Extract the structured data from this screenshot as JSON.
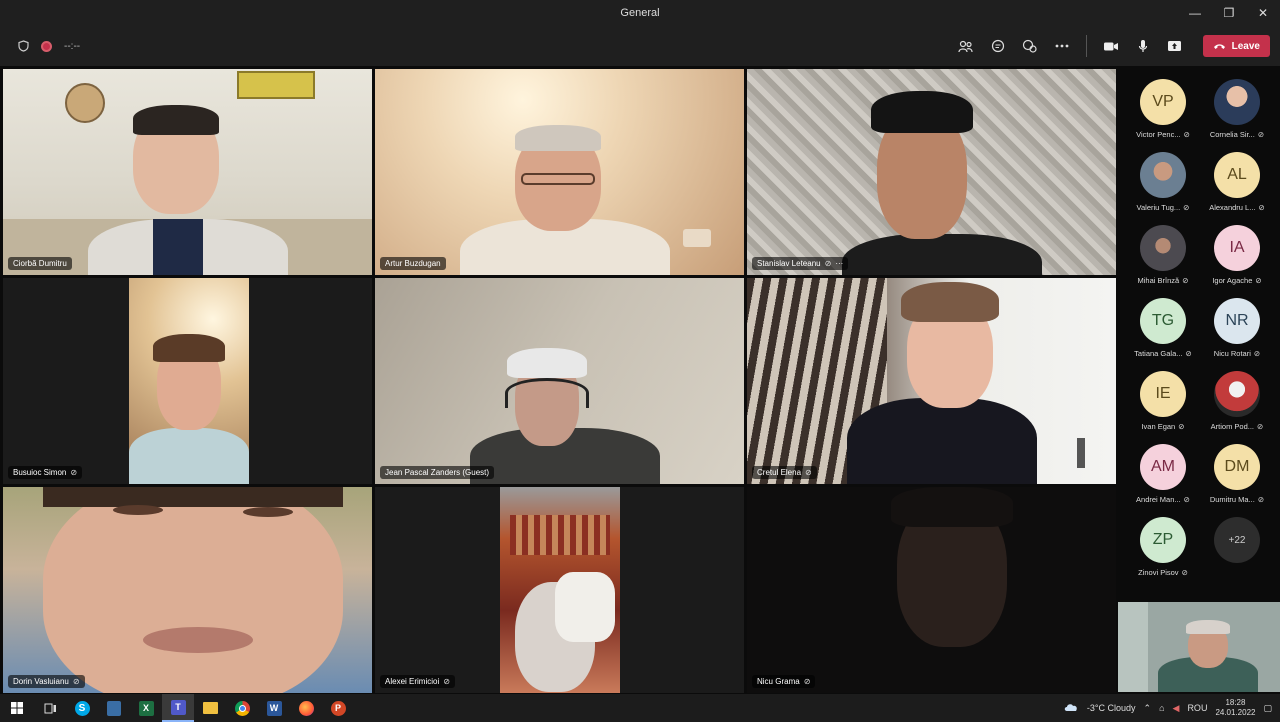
{
  "window": {
    "title": "General",
    "minimize": "—",
    "maximize": "❐",
    "close": "✕"
  },
  "toolbar": {
    "timer": "--:--",
    "leave_label": "Leave"
  },
  "tiles": [
    {
      "name": "Ciorbă Dumitru",
      "muted": false
    },
    {
      "name": "Artur Buzdugan",
      "muted": false
    },
    {
      "name": "Stanislav Leteanu",
      "muted": true,
      "more": "···"
    },
    {
      "name": "Busuioc Simon",
      "muted": true
    },
    {
      "name": "Jean Pascal Zanders (Guest)",
      "muted": false
    },
    {
      "name": "Cretul Elena",
      "muted": true
    },
    {
      "name": "Dorin Vasluianu",
      "muted": true
    },
    {
      "name": "Alexei Erimicioi",
      "muted": true
    },
    {
      "name": "Nicu Grama",
      "muted": true
    }
  ],
  "roster": [
    {
      "initials": "VP",
      "name": "Victor Penc...",
      "color": "#f4e0a8"
    },
    {
      "initials": "",
      "name": "Cornelia Sir...",
      "color": "#c9b9b0",
      "photo": true
    },
    {
      "initials": "",
      "name": "Valeriu Tug...",
      "color": "#8aa0b0",
      "photo": true
    },
    {
      "initials": "AL",
      "name": "Alexandru L...",
      "color": "#f4e0a8"
    },
    {
      "initials": "",
      "name": "Mihai Brînză",
      "color": "#6d6a70",
      "photo": true
    },
    {
      "initials": "IA",
      "name": "Igor Agache",
      "color": "#f5d1dc"
    },
    {
      "initials": "TG",
      "name": "Tatiana Gala...",
      "color": "#cfead0"
    },
    {
      "initials": "NR",
      "name": "Nicu Rotari",
      "color": "#dbe6ee"
    },
    {
      "initials": "IE",
      "name": "Ivan Egan",
      "color": "#f4e0a8"
    },
    {
      "initials": "",
      "name": "Artiom Pod...",
      "color": "#b43a3a",
      "photo": true
    },
    {
      "initials": "AM",
      "name": "Andrei Man...",
      "color": "#f5d1dc"
    },
    {
      "initials": "DM",
      "name": "Dumitru Ma...",
      "color": "#f4e0a8"
    },
    {
      "initials": "ZP",
      "name": "Zinovi Pisov",
      "color": "#cfead0"
    },
    {
      "initials": "+22",
      "name": "",
      "color": "#2d2d2d"
    }
  ],
  "taskbar": {
    "weather": "-3°C  Cloudy",
    "lang": "ROU",
    "time": "18:28",
    "date": "24.01.2022"
  }
}
